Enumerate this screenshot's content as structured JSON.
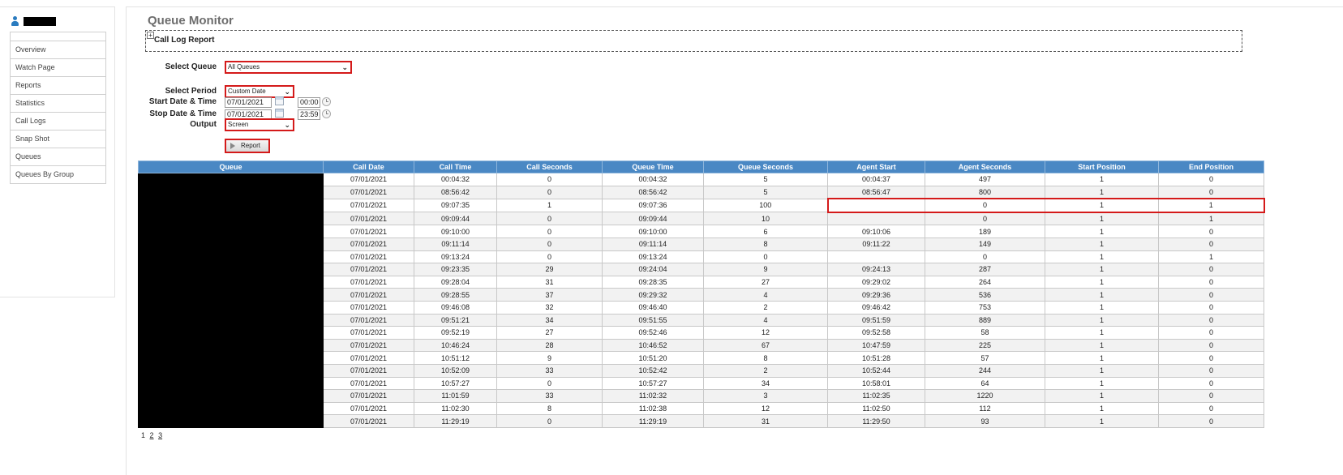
{
  "user": {
    "name": ""
  },
  "sidebar": {
    "items": [
      {
        "label": "Overview"
      },
      {
        "label": "Watch Page"
      },
      {
        "label": "Reports"
      },
      {
        "label": "Statistics"
      },
      {
        "label": "Call Logs"
      },
      {
        "label": "Snap Shot"
      },
      {
        "label": "Queues"
      },
      {
        "label": "Queues By Group"
      }
    ]
  },
  "page": {
    "title": "Queue Monitor",
    "section_title": "Call Log Report",
    "expand_symbol": "+"
  },
  "form": {
    "queue_label": "Select Queue",
    "queue_value": "All Queues",
    "period_label": "Select Period",
    "period_value": "Custom Date",
    "start_label": "Start Date & Time",
    "start_date": "07/01/2021",
    "start_time": "00:00",
    "stop_label": "Stop Date & Time",
    "stop_date": "07/01/2021",
    "stop_time": "23:59",
    "output_label": "Output",
    "output_value": "Screen",
    "report_button": "Report"
  },
  "table": {
    "columns": [
      "Queue",
      "Call Date",
      "Call Time",
      "Call Seconds",
      "Queue Time",
      "Queue Seconds",
      "Agent Start",
      "Agent Seconds",
      "Start Position",
      "End Position"
    ],
    "rows": [
      [
        "",
        "07/01/2021",
        "00:04:32",
        "0",
        "00:04:32",
        "5",
        "00:04:37",
        "497",
        "1",
        "0"
      ],
      [
        "",
        "07/01/2021",
        "08:56:42",
        "0",
        "08:56:42",
        "5",
        "08:56:47",
        "800",
        "1",
        "0"
      ],
      [
        "",
        "07/01/2021",
        "09:07:35",
        "1",
        "09:07:36",
        "100",
        "",
        "0",
        "1",
        "1"
      ],
      [
        "",
        "07/01/2021",
        "09:09:44",
        "0",
        "09:09:44",
        "10",
        "",
        "0",
        "1",
        "1"
      ],
      [
        "",
        "07/01/2021",
        "09:10:00",
        "0",
        "09:10:00",
        "6",
        "09:10:06",
        "189",
        "1",
        "0"
      ],
      [
        "",
        "07/01/2021",
        "09:11:14",
        "0",
        "09:11:14",
        "8",
        "09:11:22",
        "149",
        "1",
        "0"
      ],
      [
        "",
        "07/01/2021",
        "09:13:24",
        "0",
        "09:13:24",
        "0",
        "",
        "0",
        "1",
        "1"
      ],
      [
        "",
        "07/01/2021",
        "09:23:35",
        "29",
        "09:24:04",
        "9",
        "09:24:13",
        "287",
        "1",
        "0"
      ],
      [
        "",
        "07/01/2021",
        "09:28:04",
        "31",
        "09:28:35",
        "27",
        "09:29:02",
        "264",
        "1",
        "0"
      ],
      [
        "",
        "07/01/2021",
        "09:28:55",
        "37",
        "09:29:32",
        "4",
        "09:29:36",
        "536",
        "1",
        "0"
      ],
      [
        "",
        "07/01/2021",
        "09:46:08",
        "32",
        "09:46:40",
        "2",
        "09:46:42",
        "753",
        "1",
        "0"
      ],
      [
        "",
        "07/01/2021",
        "09:51:21",
        "34",
        "09:51:55",
        "4",
        "09:51:59",
        "889",
        "1",
        "0"
      ],
      [
        "",
        "07/01/2021",
        "09:52:19",
        "27",
        "09:52:46",
        "12",
        "09:52:58",
        "58",
        "1",
        "0"
      ],
      [
        "",
        "07/01/2021",
        "10:46:24",
        "28",
        "10:46:52",
        "67",
        "10:47:59",
        "225",
        "1",
        "0"
      ],
      [
        "",
        "07/01/2021",
        "10:51:12",
        "9",
        "10:51:20",
        "8",
        "10:51:28",
        "57",
        "1",
        "0"
      ],
      [
        "",
        "07/01/2021",
        "10:52:09",
        "33",
        "10:52:42",
        "2",
        "10:52:44",
        "244",
        "1",
        "0"
      ],
      [
        "",
        "07/01/2021",
        "10:57:27",
        "0",
        "10:57:27",
        "34",
        "10:58:01",
        "64",
        "1",
        "0"
      ],
      [
        "",
        "07/01/2021",
        "11:01:59",
        "33",
        "11:02:32",
        "3",
        "11:02:35",
        "1220",
        "1",
        "0"
      ],
      [
        "",
        "07/01/2021",
        "11:02:30",
        "8",
        "11:02:38",
        "12",
        "11:02:50",
        "112",
        "1",
        "0"
      ],
      [
        "",
        "07/01/2021",
        "11:29:19",
        "0",
        "11:29:19",
        "31",
        "11:29:50",
        "93",
        "1",
        "0"
      ]
    ],
    "highlighted_row": 2
  },
  "pager": {
    "current": "1",
    "pages": [
      "2",
      "3"
    ]
  },
  "colors": {
    "header": "#4a88c4",
    "highlight": "#d41a1a",
    "title": "#6d6d6d"
  }
}
